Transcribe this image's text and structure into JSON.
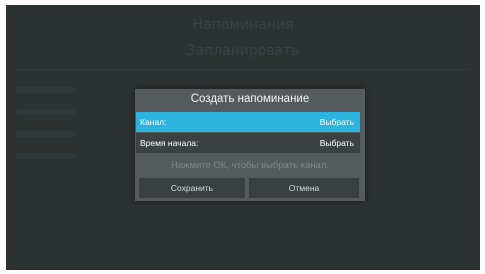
{
  "background": {
    "title": "Напоминания",
    "action": "Запланировать"
  },
  "dialog": {
    "title": "Создать напоминание",
    "fields": [
      {
        "label": "Канал:",
        "value": "Выбрать",
        "selected": true
      },
      {
        "label": "Время начала:",
        "value": "Выбрать",
        "selected": false
      }
    ],
    "hint": "Нажмите ОК, чтобы выбрать канал.",
    "buttons": {
      "save": "Сохранить",
      "cancel": "Отмена"
    }
  },
  "colors": {
    "screen_bg": "#2c3132",
    "dialog_bg": "#555b5c",
    "accent_selected": "#2bb4dd",
    "row_bg": "#3b4143",
    "button_bg": "#3a4042"
  }
}
